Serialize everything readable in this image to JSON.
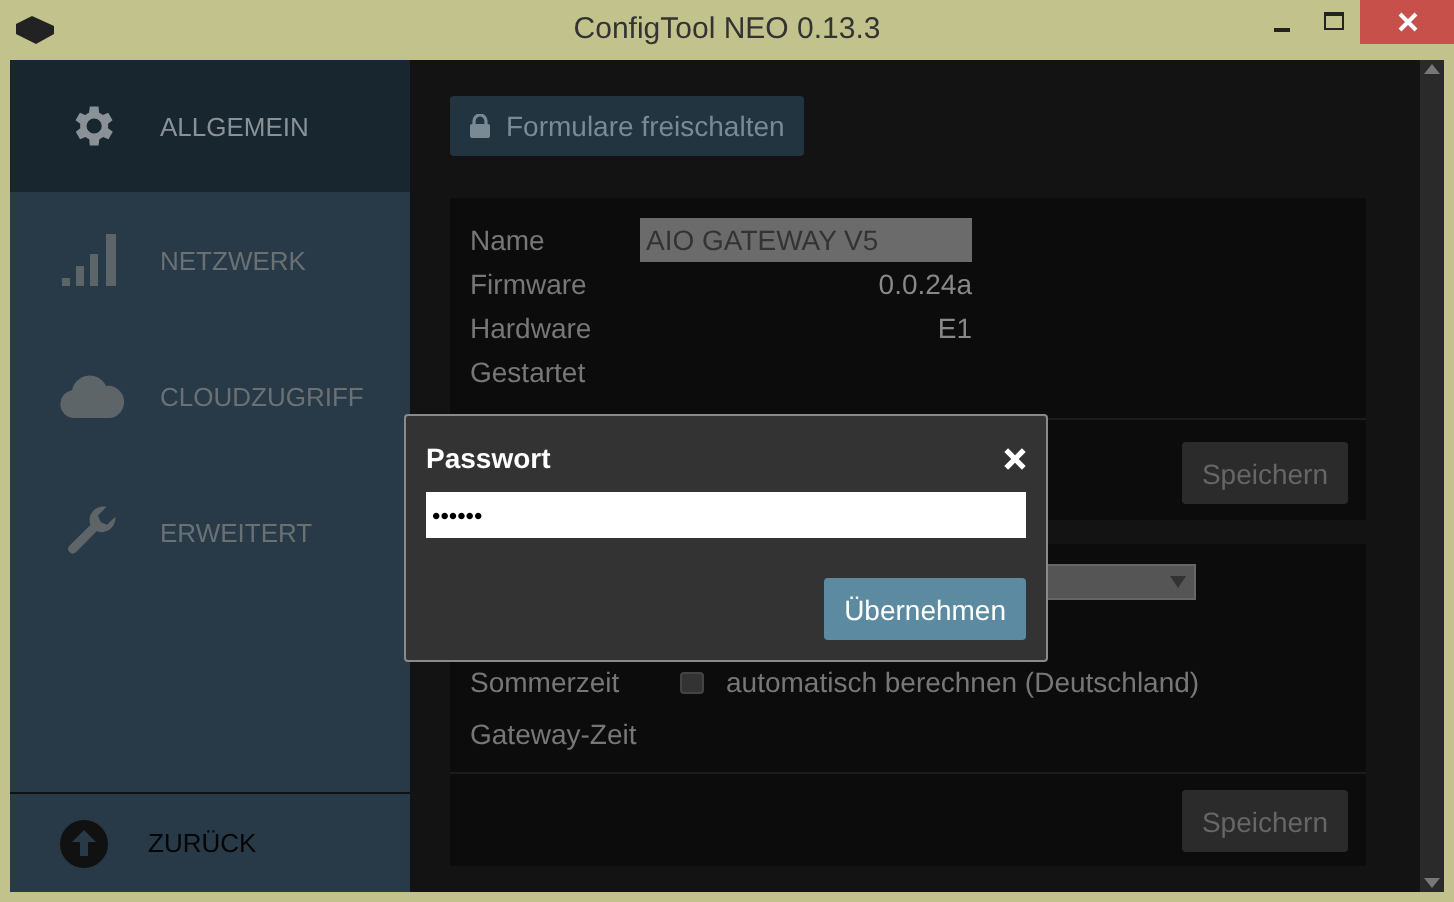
{
  "window": {
    "title": "ConfigTool NEO 0.13.3"
  },
  "sidebar": {
    "items": [
      {
        "label": "ALLGEMEIN",
        "kind": "gear",
        "selected": true
      },
      {
        "label": "NETZWERK",
        "kind": "signal",
        "selected": false
      },
      {
        "label": "CLOUDZUGRIFF",
        "kind": "cloud",
        "selected": false
      },
      {
        "label": "ERWEITERT",
        "kind": "wrench",
        "selected": false
      }
    ],
    "back": {
      "label": "ZURÜCK"
    }
  },
  "unlock_button": {
    "label": "Formulare freischalten"
  },
  "device": {
    "fields": [
      {
        "label": "Name",
        "value": "AIO GATEWAY V5",
        "kind": "input"
      },
      {
        "label": "Firmware",
        "value": "0.0.24a",
        "kind": "text"
      },
      {
        "label": "Hardware",
        "value": "E1",
        "kind": "text"
      },
      {
        "label": "Gestartet",
        "kind": "text"
      }
    ],
    "save": "Speichern"
  },
  "time": {
    "dst": {
      "label": "Sommerzeit",
      "checked": false,
      "text": "automatisch berechnen (Deutschland)"
    },
    "gateway_time": {
      "label": "Gateway-Zeit"
    }
  },
  "footer": {
    "save": "Speichern"
  },
  "dialog": {
    "title": "Passwort",
    "value": "••••••",
    "button": "Übernehmen"
  }
}
